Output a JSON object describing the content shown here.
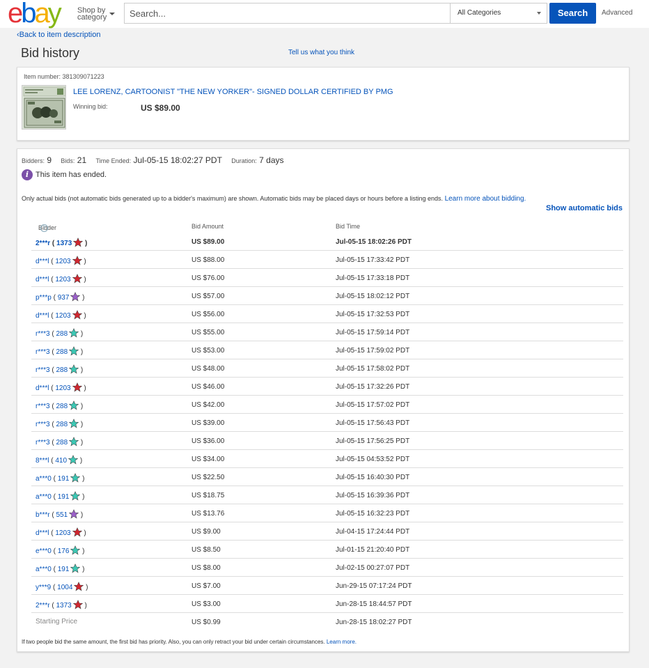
{
  "header": {
    "logo_letters": [
      "e",
      "b",
      "a",
      "y"
    ],
    "shop_by_line1": "Shop by",
    "shop_by_line2": "category",
    "search_placeholder": "Search...",
    "category": "All Categories",
    "search_button": "Search",
    "advanced": "Advanced"
  },
  "back_link": "Back to item description",
  "page_title": "Bid history",
  "feedback_link": "Tell us what you think",
  "item": {
    "number_label": "Item number:",
    "number": "381309071223",
    "title": "LEE LORENZ, CARTOONIST \"THE NEW YORKER\"- SIGNED DOLLAR CERTIFIED BY PMG",
    "winning_label": "Winning bid:",
    "winning_value": "US $89.00"
  },
  "stats": {
    "bidders_label": "Bidders:",
    "bidders": "9",
    "bids_label": "Bids:",
    "bids": "21",
    "ended_label": "Time Ended:",
    "ended": "Jul-05-15 18:02:27 PDT",
    "duration_label": "Duration:",
    "duration": "7 days"
  },
  "ended_message": "This item has ended.",
  "notice": {
    "text": "Only actual bids (not automatic bids generated up to a bidder's maximum) are shown. Automatic bids may be placed days or hours before a listing ends.",
    "link": "Learn more about bidding."
  },
  "show_automatic": "Show automatic bids",
  "columns": {
    "bidder": "Bidder",
    "amount": "Bid Amount",
    "time": "Bid Time"
  },
  "star_colors": {
    "red": "#d0262f",
    "turquoise": "#3cc8b4",
    "purple": "#9b5fc9"
  },
  "bids": [
    {
      "bidder": "2***r",
      "score": "1373",
      "star": "red",
      "amount": "US $89.00",
      "time": "Jul-05-15 18:02:26 PDT"
    },
    {
      "bidder": "d***l",
      "score": "1203",
      "star": "red",
      "amount": "US $88.00",
      "time": "Jul-05-15 17:33:42 PDT"
    },
    {
      "bidder": "d***l",
      "score": "1203",
      "star": "red",
      "amount": "US $76.00",
      "time": "Jul-05-15 17:33:18 PDT"
    },
    {
      "bidder": "p***p",
      "score": "937",
      "star": "purple",
      "amount": "US $57.00",
      "time": "Jul-05-15 18:02:12 PDT"
    },
    {
      "bidder": "d***l",
      "score": "1203",
      "star": "red",
      "amount": "US $56.00",
      "time": "Jul-05-15 17:32:53 PDT"
    },
    {
      "bidder": "r***3",
      "score": "288",
      "star": "turquoise",
      "amount": "US $55.00",
      "time": "Jul-05-15 17:59:14 PDT"
    },
    {
      "bidder": "r***3",
      "score": "288",
      "star": "turquoise",
      "amount": "US $53.00",
      "time": "Jul-05-15 17:59:02 PDT"
    },
    {
      "bidder": "r***3",
      "score": "288",
      "star": "turquoise",
      "amount": "US $48.00",
      "time": "Jul-05-15 17:58:02 PDT"
    },
    {
      "bidder": "d***l",
      "score": "1203",
      "star": "red",
      "amount": "US $46.00",
      "time": "Jul-05-15 17:32:26 PDT"
    },
    {
      "bidder": "r***3",
      "score": "288",
      "star": "turquoise",
      "amount": "US $42.00",
      "time": "Jul-05-15 17:57:02 PDT"
    },
    {
      "bidder": "r***3",
      "score": "288",
      "star": "turquoise",
      "amount": "US $39.00",
      "time": "Jul-05-15 17:56:43 PDT"
    },
    {
      "bidder": "r***3",
      "score": "288",
      "star": "turquoise",
      "amount": "US $36.00",
      "time": "Jul-05-15 17:56:25 PDT"
    },
    {
      "bidder": "8***l",
      "score": "410",
      "star": "turquoise",
      "amount": "US $34.00",
      "time": "Jul-05-15 04:53:52 PDT"
    },
    {
      "bidder": "a***0",
      "score": "191",
      "star": "turquoise",
      "amount": "US $22.50",
      "time": "Jul-05-15 16:40:30 PDT"
    },
    {
      "bidder": "a***0",
      "score": "191",
      "star": "turquoise",
      "amount": "US $18.75",
      "time": "Jul-05-15 16:39:36 PDT"
    },
    {
      "bidder": "b***r",
      "score": "551",
      "star": "purple",
      "amount": "US $13.76",
      "time": "Jul-05-15 16:32:23 PDT"
    },
    {
      "bidder": "d***l",
      "score": "1203",
      "star": "red",
      "amount": "US $9.00",
      "time": "Jul-04-15 17:24:44 PDT"
    },
    {
      "bidder": "e***0",
      "score": "176",
      "star": "turquoise",
      "amount": "US $8.50",
      "time": "Jul-01-15 21:20:40 PDT"
    },
    {
      "bidder": "a***0",
      "score": "191",
      "star": "turquoise",
      "amount": "US $8.00",
      "time": "Jul-02-15 00:27:07 PDT"
    },
    {
      "bidder": "y***9",
      "score": "1004",
      "star": "red",
      "amount": "US $7.00",
      "time": "Jun-29-15 07:17:24 PDT"
    },
    {
      "bidder": "2***r",
      "score": "1373",
      "star": "red",
      "amount": "US $3.00",
      "time": "Jun-28-15 18:44:57 PDT"
    }
  ],
  "starting": {
    "label": "Starting Price",
    "amount": "US $0.99",
    "time": "Jun-28-15 18:02:27 PDT"
  },
  "footnote": {
    "text": "If two people bid the same amount, the first bid has priority. Also, you can only retract your bid under certain circumstances.",
    "link": "Learn more."
  }
}
